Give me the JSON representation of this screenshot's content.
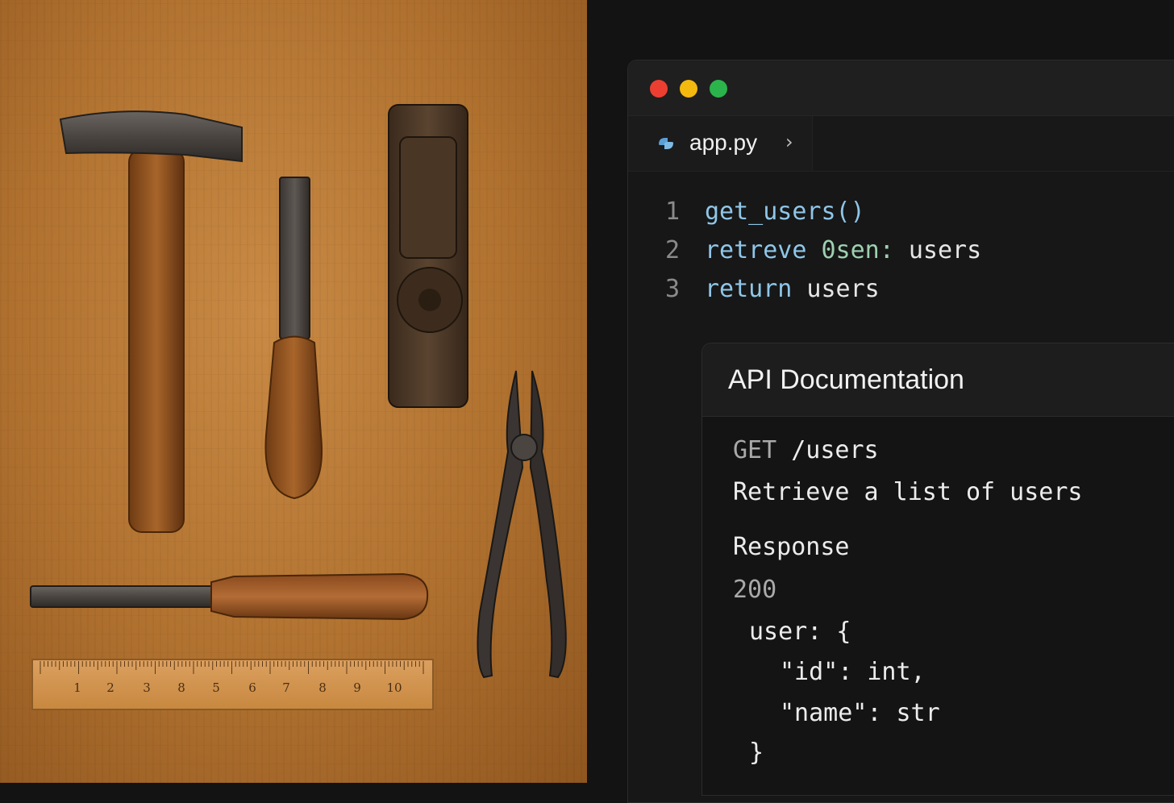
{
  "editor": {
    "window_controls": [
      "close",
      "minimize",
      "maximize"
    ],
    "tab": {
      "filename": "app.py",
      "icon": "python-file-icon",
      "chevron": "›"
    },
    "code_lines": [
      {
        "number": "1",
        "parts": [
          {
            "text": "get_users()",
            "kind": "kw"
          }
        ]
      },
      {
        "number": "2",
        "parts": [
          {
            "text": "retreve ",
            "kind": "kw"
          },
          {
            "text": "0sen:",
            "kind": "var"
          },
          {
            "text": " users",
            "kind": "plain"
          }
        ]
      },
      {
        "number": "3",
        "parts": [
          {
            "text": "return",
            "kind": "kw"
          },
          {
            "text": " users",
            "kind": "plain"
          }
        ]
      }
    ]
  },
  "doc_panel": {
    "title": "API Documentation",
    "method": "GET",
    "path": "/users",
    "description": "Retrieve a list of users",
    "response_label": "Response",
    "status_code": "200",
    "body_lines": [
      "user: {",
      "\"id\": int,",
      "\"name\": str",
      "}"
    ]
  },
  "ruler": {
    "numbers": [
      "1",
      "2",
      "3",
      "8",
      "5",
      "6",
      "7",
      "8",
      "9",
      "10"
    ]
  },
  "colors": {
    "keyword": "#8fc6e8",
    "variable": "#9ed0b0",
    "text": "#e6e6e6",
    "close": "#ec3f32",
    "minimize": "#f3b90f",
    "maximize": "#2bb44b"
  }
}
